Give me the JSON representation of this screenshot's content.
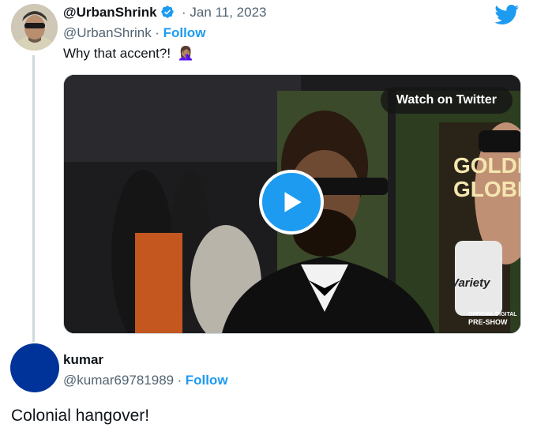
{
  "tweet": {
    "display_name": "@UrbanShrink",
    "handle": "@UrbanShrink",
    "date": "· Jan 11, 2023",
    "follow_label": "Follow",
    "text": "Why that accent?!",
    "emoji": "🤦🏽‍♀️",
    "verified": true,
    "media": {
      "watch_label": "Watch on Twitter",
      "sign_text": "GOLDEN GLOBE",
      "mic_text": "Variety",
      "badge_line1": "OFFICIAL DIGITAL",
      "badge_line2": "PRE-SHOW"
    }
  },
  "reply": {
    "display_name": "kumar",
    "handle": "@kumar69781989",
    "separator": "·",
    "follow_label": "Follow",
    "text": "Colonial hangover!"
  },
  "colors": {
    "accent": "#1d9bf0",
    "text": "#0f1419",
    "muted": "#536471",
    "avatar_reply": "#003399"
  },
  "icons": [
    "twitter-bird-icon",
    "verified-badge-icon",
    "play-icon"
  ]
}
